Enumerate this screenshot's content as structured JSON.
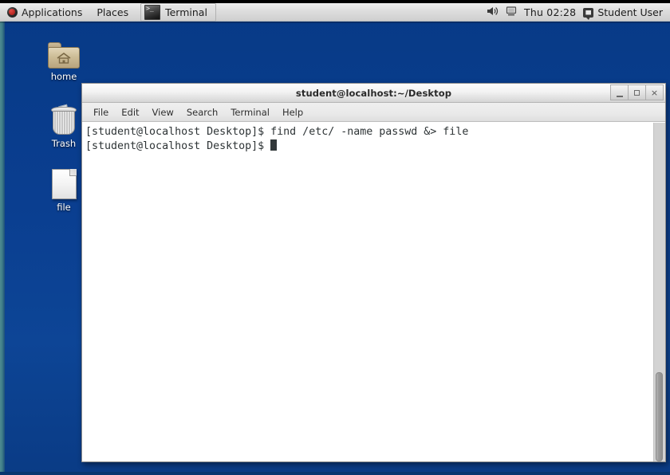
{
  "panel": {
    "logo_icon": "fedora-logo-icon",
    "applications_label": "Applications",
    "places_label": "Places",
    "taskbar": {
      "terminal_label": "Terminal",
      "terminal_icon": "terminal-icon"
    },
    "tray": {
      "volume_icon": "volume-icon",
      "display_icon": "display-icon",
      "clock": "Thu 02:28",
      "user_icon": "user-indicator-icon",
      "user_label": "Student User"
    }
  },
  "desktop": {
    "icons": [
      {
        "label": "home",
        "icon": "home-folder-icon"
      },
      {
        "label": "Trash",
        "icon": "trash-icon"
      },
      {
        "label": "file",
        "icon": "document-icon"
      }
    ],
    "background_color": "#0a3e90"
  },
  "terminal": {
    "title": "student@localhost:~/Desktop",
    "window_buttons": {
      "minimize": "minimize-button",
      "maximize": "maximize-button",
      "close": "×"
    },
    "menu": [
      "File",
      "Edit",
      "View",
      "Search",
      "Terminal",
      "Help"
    ],
    "lines": [
      "[student@localhost Desktop]$ find /etc/ -name passwd &> file",
      "[student@localhost Desktop]$ "
    ],
    "prompt": "[student@localhost Desktop]$ ",
    "command": "find /etc/ -name passwd &> file",
    "foreground_color": "#2e3436",
    "background_color": "#ffffff"
  }
}
